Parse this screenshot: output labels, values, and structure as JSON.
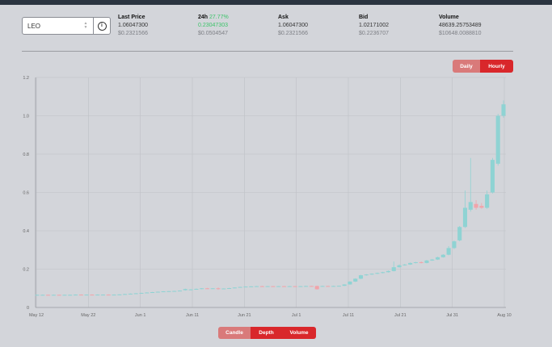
{
  "market": {
    "value": "LEO"
  },
  "stats": {
    "last_price": {
      "label": "Last Price",
      "value": "1.06047300",
      "usd": "$0.2321566"
    },
    "change_24h": {
      "label": "24h",
      "percent": "27.77%",
      "value": "0.23047303",
      "usd": "$0.0504547"
    },
    "ask": {
      "label": "Ask",
      "value": "1.06047300",
      "usd": "$0.2321566"
    },
    "bid": {
      "label": "Bid",
      "value": "1.02171002",
      "usd": "$0.2236707"
    },
    "volume": {
      "label": "Volume",
      "value": "48639.25753489",
      "usd": "$10648.0088810"
    }
  },
  "range_toggle": {
    "daily": "Daily",
    "hourly": "Hourly",
    "active": "hourly"
  },
  "chart_toggle": {
    "candle": "Candle",
    "depth": "Depth",
    "volume": "Volume",
    "active": [
      "depth",
      "volume"
    ]
  },
  "colors": {
    "up": "#8fd3d3",
    "down": "#f1a4aa",
    "accent": "#d9272b",
    "change_positive": "#3cc46a"
  },
  "chart_data": {
    "type": "candlestick",
    "x_ticks": [
      "May 12",
      "May 22",
      "Jun 1",
      "Jun 11",
      "Jun 21",
      "Jul 1",
      "Jul 11",
      "Jul 21",
      "Jul 31",
      "Aug 10"
    ],
    "y_ticks": [
      "0",
      "0.2",
      "0.4",
      "0.6",
      "0.8",
      "1.0",
      "1.2"
    ],
    "ylim": [
      0,
      1.2
    ],
    "grid": true,
    "series": [
      {
        "values": [
          {
            "o": 0.065,
            "c": 0.066,
            "h": 0.067,
            "l": 0.064,
            "dir": "up"
          },
          {
            "o": 0.066,
            "c": 0.066,
            "h": 0.067,
            "l": 0.065,
            "dir": "up"
          },
          {
            "o": 0.066,
            "c": 0.065,
            "h": 0.067,
            "l": 0.064,
            "dir": "down"
          },
          {
            "o": 0.065,
            "c": 0.066,
            "h": 0.067,
            "l": 0.064,
            "dir": "up"
          },
          {
            "o": 0.066,
            "c": 0.065,
            "h": 0.067,
            "l": 0.064,
            "dir": "down"
          },
          {
            "o": 0.065,
            "c": 0.066,
            "h": 0.067,
            "l": 0.064,
            "dir": "up"
          },
          {
            "o": 0.066,
            "c": 0.066,
            "h": 0.067,
            "l": 0.065,
            "dir": "up"
          },
          {
            "o": 0.066,
            "c": 0.067,
            "h": 0.068,
            "l": 0.065,
            "dir": "up"
          },
          {
            "o": 0.067,
            "c": 0.066,
            "h": 0.068,
            "l": 0.065,
            "dir": "down"
          },
          {
            "o": 0.066,
            "c": 0.067,
            "h": 0.068,
            "l": 0.065,
            "dir": "up"
          },
          {
            "o": 0.067,
            "c": 0.066,
            "h": 0.068,
            "l": 0.065,
            "dir": "down"
          },
          {
            "o": 0.066,
            "c": 0.067,
            "h": 0.068,
            "l": 0.065,
            "dir": "up"
          },
          {
            "o": 0.067,
            "c": 0.067,
            "h": 0.068,
            "l": 0.066,
            "dir": "up"
          },
          {
            "o": 0.067,
            "c": 0.066,
            "h": 0.068,
            "l": 0.065,
            "dir": "down"
          },
          {
            "o": 0.066,
            "c": 0.067,
            "h": 0.068,
            "l": 0.065,
            "dir": "up"
          },
          {
            "o": 0.067,
            "c": 0.068,
            "h": 0.069,
            "l": 0.066,
            "dir": "up"
          },
          {
            "o": 0.068,
            "c": 0.07,
            "h": 0.071,
            "l": 0.067,
            "dir": "up"
          },
          {
            "o": 0.07,
            "c": 0.072,
            "h": 0.073,
            "l": 0.069,
            "dir": "up"
          },
          {
            "o": 0.072,
            "c": 0.074,
            "h": 0.075,
            "l": 0.071,
            "dir": "up"
          },
          {
            "o": 0.074,
            "c": 0.076,
            "h": 0.077,
            "l": 0.073,
            "dir": "up"
          },
          {
            "o": 0.076,
            "c": 0.078,
            "h": 0.079,
            "l": 0.075,
            "dir": "up"
          },
          {
            "o": 0.078,
            "c": 0.08,
            "h": 0.081,
            "l": 0.077,
            "dir": "up"
          },
          {
            "o": 0.08,
            "c": 0.082,
            "h": 0.083,
            "l": 0.079,
            "dir": "up"
          },
          {
            "o": 0.082,
            "c": 0.084,
            "h": 0.085,
            "l": 0.081,
            "dir": "up"
          },
          {
            "o": 0.084,
            "c": 0.085,
            "h": 0.086,
            "l": 0.083,
            "dir": "up"
          },
          {
            "o": 0.085,
            "c": 0.086,
            "h": 0.087,
            "l": 0.084,
            "dir": "up"
          },
          {
            "o": 0.086,
            "c": 0.088,
            "h": 0.089,
            "l": 0.085,
            "dir": "up"
          },
          {
            "o": 0.09,
            "c": 0.096,
            "h": 0.098,
            "l": 0.088,
            "dir": "up"
          },
          {
            "o": 0.092,
            "c": 0.094,
            "h": 0.096,
            "l": 0.09,
            "dir": "up"
          },
          {
            "o": 0.094,
            "c": 0.097,
            "h": 0.099,
            "l": 0.093,
            "dir": "up"
          },
          {
            "o": 0.097,
            "c": 0.1,
            "h": 0.101,
            "l": 0.095,
            "dir": "up"
          },
          {
            "o": 0.1,
            "c": 0.098,
            "h": 0.102,
            "l": 0.096,
            "dir": "down"
          },
          {
            "o": 0.098,
            "c": 0.1,
            "h": 0.101,
            "l": 0.097,
            "dir": "up"
          },
          {
            "o": 0.1,
            "c": 0.097,
            "h": 0.104,
            "l": 0.092,
            "dir": "down"
          },
          {
            "o": 0.097,
            "c": 0.099,
            "h": 0.1,
            "l": 0.096,
            "dir": "up"
          },
          {
            "o": 0.099,
            "c": 0.101,
            "h": 0.102,
            "l": 0.098,
            "dir": "up"
          },
          {
            "o": 0.101,
            "c": 0.104,
            "h": 0.105,
            "l": 0.1,
            "dir": "up"
          },
          {
            "o": 0.104,
            "c": 0.107,
            "h": 0.108,
            "l": 0.103,
            "dir": "up"
          },
          {
            "o": 0.107,
            "c": 0.109,
            "h": 0.11,
            "l": 0.106,
            "dir": "up"
          },
          {
            "o": 0.109,
            "c": 0.11,
            "h": 0.111,
            "l": 0.108,
            "dir": "up"
          },
          {
            "o": 0.11,
            "c": 0.111,
            "h": 0.112,
            "l": 0.109,
            "dir": "up"
          },
          {
            "o": 0.111,
            "c": 0.11,
            "h": 0.113,
            "l": 0.109,
            "dir": "down"
          },
          {
            "o": 0.11,
            "c": 0.111,
            "h": 0.112,
            "l": 0.109,
            "dir": "up"
          },
          {
            "o": 0.111,
            "c": 0.11,
            "h": 0.112,
            "l": 0.109,
            "dir": "down"
          },
          {
            "o": 0.11,
            "c": 0.111,
            "h": 0.112,
            "l": 0.109,
            "dir": "up"
          },
          {
            "o": 0.111,
            "c": 0.11,
            "h": 0.112,
            "l": 0.109,
            "dir": "down"
          },
          {
            "o": 0.11,
            "c": 0.111,
            "h": 0.112,
            "l": 0.109,
            "dir": "up"
          },
          {
            "o": 0.111,
            "c": 0.11,
            "h": 0.112,
            "l": 0.109,
            "dir": "down"
          },
          {
            "o": 0.11,
            "c": 0.111,
            "h": 0.112,
            "l": 0.109,
            "dir": "up"
          },
          {
            "o": 0.111,
            "c": 0.112,
            "h": 0.113,
            "l": 0.11,
            "dir": "up"
          },
          {
            "o": 0.112,
            "c": 0.111,
            "h": 0.113,
            "l": 0.11,
            "dir": "down"
          },
          {
            "o": 0.112,
            "c": 0.095,
            "h": 0.114,
            "l": 0.093,
            "dir": "down"
          },
          {
            "o": 0.111,
            "c": 0.112,
            "h": 0.113,
            "l": 0.11,
            "dir": "up"
          },
          {
            "o": 0.112,
            "c": 0.111,
            "h": 0.113,
            "l": 0.11,
            "dir": "down"
          },
          {
            "o": 0.111,
            "c": 0.112,
            "h": 0.113,
            "l": 0.11,
            "dir": "up"
          },
          {
            "o": 0.112,
            "c": 0.113,
            "h": 0.114,
            "l": 0.111,
            "dir": "up"
          },
          {
            "o": 0.113,
            "c": 0.12,
            "h": 0.121,
            "l": 0.112,
            "dir": "up"
          },
          {
            "o": 0.12,
            "c": 0.135,
            "h": 0.137,
            "l": 0.119,
            "dir": "up"
          },
          {
            "o": 0.135,
            "c": 0.15,
            "h": 0.152,
            "l": 0.133,
            "dir": "up"
          },
          {
            "o": 0.15,
            "c": 0.168,
            "h": 0.17,
            "l": 0.148,
            "dir": "up"
          },
          {
            "o": 0.168,
            "c": 0.172,
            "h": 0.174,
            "l": 0.166,
            "dir": "up"
          },
          {
            "o": 0.172,
            "c": 0.176,
            "h": 0.178,
            "l": 0.17,
            "dir": "up"
          },
          {
            "o": 0.176,
            "c": 0.18,
            "h": 0.182,
            "l": 0.174,
            "dir": "up"
          },
          {
            "o": 0.18,
            "c": 0.184,
            "h": 0.186,
            "l": 0.178,
            "dir": "up"
          },
          {
            "o": 0.184,
            "c": 0.19,
            "h": 0.193,
            "l": 0.182,
            "dir": "up"
          },
          {
            "o": 0.19,
            "c": 0.21,
            "h": 0.24,
            "l": 0.188,
            "dir": "up"
          },
          {
            "o": 0.21,
            "c": 0.22,
            "h": 0.225,
            "l": 0.208,
            "dir": "up"
          },
          {
            "o": 0.22,
            "c": 0.224,
            "h": 0.227,
            "l": 0.218,
            "dir": "up"
          },
          {
            "o": 0.224,
            "c": 0.232,
            "h": 0.235,
            "l": 0.222,
            "dir": "up"
          },
          {
            "o": 0.232,
            "c": 0.236,
            "h": 0.238,
            "l": 0.23,
            "dir": "up"
          },
          {
            "o": 0.236,
            "c": 0.232,
            "h": 0.24,
            "l": 0.23,
            "dir": "down"
          },
          {
            "o": 0.232,
            "c": 0.245,
            "h": 0.248,
            "l": 0.23,
            "dir": "up"
          },
          {
            "o": 0.245,
            "c": 0.25,
            "h": 0.253,
            "l": 0.243,
            "dir": "up"
          },
          {
            "o": 0.25,
            "c": 0.262,
            "h": 0.265,
            "l": 0.248,
            "dir": "up"
          },
          {
            "o": 0.262,
            "c": 0.275,
            "h": 0.278,
            "l": 0.26,
            "dir": "up"
          },
          {
            "o": 0.275,
            "c": 0.31,
            "h": 0.32,
            "l": 0.272,
            "dir": "up"
          },
          {
            "o": 0.31,
            "c": 0.345,
            "h": 0.35,
            "l": 0.305,
            "dir": "up"
          },
          {
            "o": 0.35,
            "c": 0.42,
            "h": 0.425,
            "l": 0.345,
            "dir": "up"
          },
          {
            "o": 0.42,
            "c": 0.52,
            "h": 0.61,
            "l": 0.415,
            "dir": "up"
          },
          {
            "o": 0.51,
            "c": 0.55,
            "h": 0.78,
            "l": 0.5,
            "dir": "up"
          },
          {
            "o": 0.54,
            "c": 0.52,
            "h": 0.56,
            "l": 0.51,
            "dir": "down"
          },
          {
            "o": 0.53,
            "c": 0.52,
            "h": 0.545,
            "l": 0.515,
            "dir": "down"
          },
          {
            "o": 0.52,
            "c": 0.59,
            "h": 0.61,
            "l": 0.515,
            "dir": "up"
          },
          {
            "o": 0.6,
            "c": 0.77,
            "h": 0.78,
            "l": 0.595,
            "dir": "up"
          },
          {
            "o": 0.75,
            "c": 1.0,
            "h": 1.01,
            "l": 0.74,
            "dir": "up"
          },
          {
            "o": 1.0,
            "c": 1.06,
            "h": 1.08,
            "l": 0.99,
            "dir": "up"
          }
        ]
      }
    ]
  }
}
